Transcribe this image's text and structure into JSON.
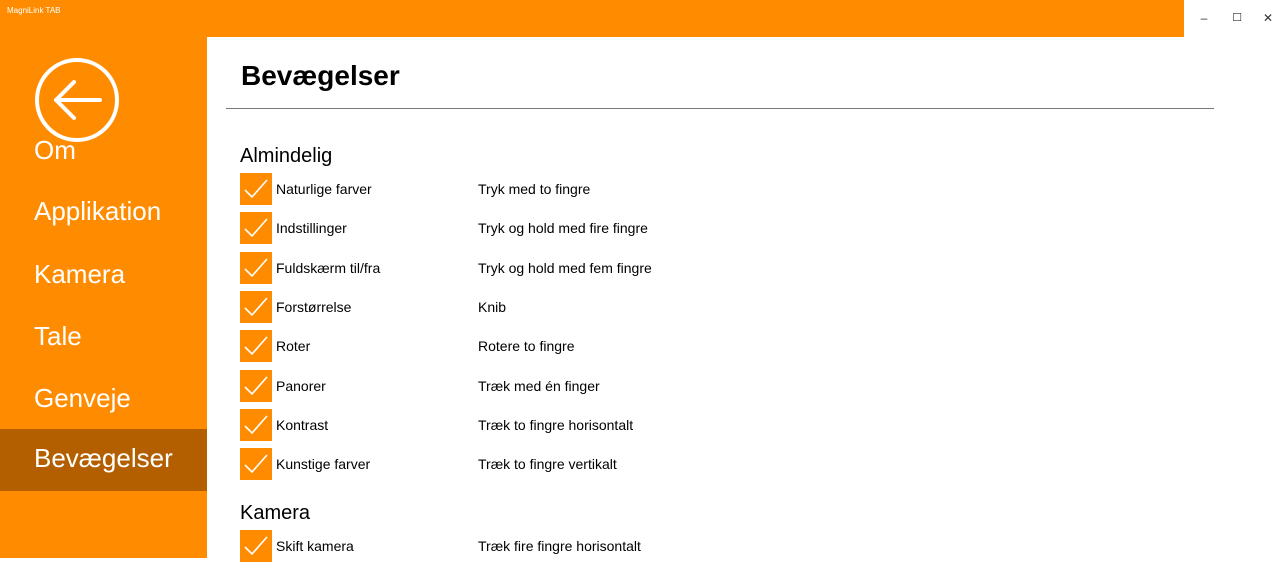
{
  "window": {
    "title": "MagniLink TAB",
    "minimize_label": "–",
    "maximize_label": "☐",
    "close_label": "✕"
  },
  "sidebar": {
    "back_icon": "back-arrow-circle-icon",
    "items": [
      {
        "label": "Om",
        "selected": false
      },
      {
        "label": "Applikation",
        "selected": false
      },
      {
        "label": "Kamera",
        "selected": false
      },
      {
        "label": "Tale",
        "selected": false
      },
      {
        "label": "Genveje",
        "selected": false
      },
      {
        "label": "Bevægelser",
        "selected": true
      }
    ]
  },
  "main": {
    "title": "Bevægelser",
    "sections": [
      {
        "title": "Almindelig",
        "rows": [
          {
            "label": "Naturlige farver",
            "gesture": "Tryk med to fingre",
            "checked": true
          },
          {
            "label": "Indstillinger",
            "gesture": "Tryk og hold med fire fingre",
            "checked": true
          },
          {
            "label": "Fuldskærm til/fra",
            "gesture": "Tryk og hold med fem fingre",
            "checked": true
          },
          {
            "label": "Forstørrelse",
            "gesture": "Knib",
            "checked": true
          },
          {
            "label": "Roter",
            "gesture": "Rotere to fingre",
            "checked": true
          },
          {
            "label": "Panorer",
            "gesture": "Træk med én finger",
            "checked": true
          },
          {
            "label": "Kontrast",
            "gesture": "Træk to fingre horisontalt",
            "checked": true
          },
          {
            "label": "Kunstige farver",
            "gesture": "Træk to fingre vertikalt",
            "checked": true
          }
        ]
      },
      {
        "title": "Kamera",
        "rows": [
          {
            "label": "Skift kamera",
            "gesture": "Træk fire fingre horisontalt",
            "checked": true
          }
        ]
      }
    ]
  },
  "colors": {
    "accent": "#FF8C00",
    "selected": "#B35F00"
  }
}
